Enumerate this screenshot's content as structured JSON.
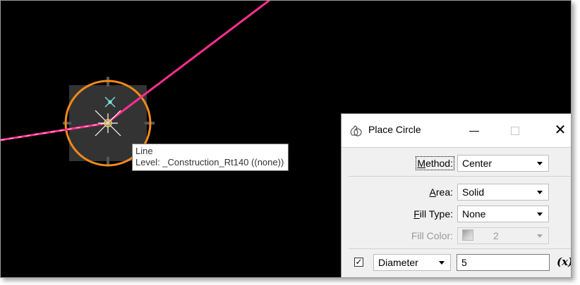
{
  "tooltip": {
    "line1": "Line",
    "line2": "Level: _Construction_Rt140 ((none))"
  },
  "dialog": {
    "title": "Place Circle",
    "icon": "place-circle-icon",
    "close_glyph": "✕",
    "method": {
      "label_pre": "",
      "label_key": "M",
      "label_post": "ethod:",
      "value": "Center"
    },
    "area": {
      "label_pre": "",
      "label_key": "A",
      "label_post": "rea:",
      "value": "Solid"
    },
    "fill_type": {
      "label_pre": "",
      "label_key": "F",
      "label_post": "ill Type:",
      "value": "None"
    },
    "fill_color": {
      "label": "Fill Color:",
      "value": "2"
    },
    "diameter": {
      "checked": "☑",
      "mode": "Diameter",
      "value": "5",
      "fx": "(x)"
    }
  },
  "colors": {
    "background": "#000000",
    "line": "#ff2f8f",
    "circle": "#f28a1a",
    "selection_box": "#333333"
  }
}
